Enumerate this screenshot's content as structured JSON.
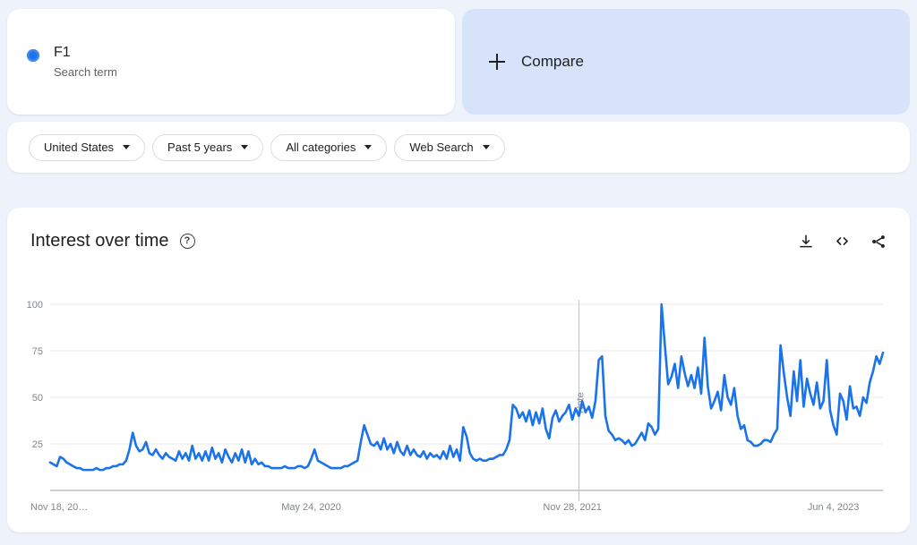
{
  "terms": [
    {
      "title": "F1",
      "subtitle": "Search term",
      "dot_color": "#1a73e8"
    }
  ],
  "compare": {
    "label": "Compare",
    "icon": "plus-icon",
    "bg_color": "#d7e3f9"
  },
  "filters": [
    {
      "label": "United States",
      "icon": "chevron-down-icon"
    },
    {
      "label": "Past 5 years",
      "icon": "chevron-down-icon"
    },
    {
      "label": "All categories",
      "icon": "chevron-down-icon"
    },
    {
      "label": "Web Search",
      "icon": "chevron-down-icon"
    }
  ],
  "chart_card": {
    "title": "Interest over time",
    "help_icon": "help-circle-icon",
    "help_glyph": "?",
    "actions": [
      {
        "name": "download-icon",
        "label": "Download"
      },
      {
        "name": "embed-code-icon",
        "label": "Embed"
      },
      {
        "name": "share-icon",
        "label": "Share"
      }
    ]
  },
  "chart_data": {
    "type": "line",
    "title": "Interest over time",
    "subtitle": "",
    "xlabel": "",
    "ylabel": "",
    "ylim": [
      0,
      100
    ],
    "yticks": [
      25,
      50,
      75,
      100
    ],
    "grid": true,
    "legend": false,
    "line_color": "#1a73e8",
    "annotations": [
      {
        "type": "vline",
        "label": "Note",
        "x_index": 160,
        "x_date": "Dec 2021"
      }
    ],
    "xticks": [
      {
        "label": "Nov 18, 20…",
        "index": 0
      },
      {
        "label": "May 24, 2020",
        "index": 79
      },
      {
        "index": 158,
        "label": "Nov 28, 2021"
      },
      {
        "label": "Jun 4, 2023",
        "index": 237
      }
    ],
    "x_start": "Nov 18, 2018",
    "x_end": "Nov 2023",
    "series": [
      {
        "name": "F1",
        "color": "#1a73e8",
        "values": [
          15,
          14,
          13,
          18,
          17,
          15,
          14,
          13,
          12,
          12,
          11,
          11,
          11,
          11,
          12,
          11,
          11,
          12,
          12,
          13,
          13,
          14,
          14,
          16,
          22,
          31,
          24,
          21,
          22,
          26,
          20,
          19,
          22,
          19,
          17,
          20,
          18,
          17,
          16,
          21,
          17,
          20,
          16,
          24,
          17,
          20,
          16,
          21,
          16,
          23,
          17,
          20,
          15,
          22,
          18,
          15,
          20,
          16,
          22,
          15,
          21,
          14,
          17,
          14,
          15,
          13,
          13,
          12,
          12,
          12,
          12,
          13,
          12,
          12,
          12,
          13,
          13,
          12,
          13,
          17,
          22,
          16,
          15,
          14,
          13,
          12,
          12,
          12,
          12,
          13,
          13,
          14,
          15,
          16,
          26,
          35,
          30,
          25,
          24,
          26,
          22,
          28,
          22,
          25,
          20,
          26,
          21,
          19,
          24,
          19,
          22,
          19,
          18,
          21,
          17,
          20,
          18,
          19,
          17,
          21,
          17,
          24,
          18,
          22,
          16,
          34,
          29,
          20,
          17,
          16,
          17,
          16,
          16,
          17,
          17,
          18,
          19,
          19,
          22,
          27,
          46,
          44,
          39,
          42,
          37,
          43,
          35,
          42,
          36,
          44,
          33,
          28,
          39,
          43,
          37,
          40,
          42,
          46,
          38,
          44,
          40,
          48,
          42,
          45,
          39,
          48,
          70,
          72,
          40,
          32,
          30,
          27,
          28,
          27,
          25,
          27,
          24,
          25,
          28,
          31,
          27,
          36,
          34,
          30,
          33,
          100,
          78,
          57,
          61,
          68,
          55,
          72,
          63,
          56,
          62,
          55,
          66,
          52,
          82,
          56,
          44,
          48,
          53,
          43,
          62,
          50,
          46,
          55,
          40,
          33,
          35,
          27,
          26,
          24,
          24,
          25,
          27,
          27,
          26,
          30,
          33,
          78,
          63,
          50,
          40,
          64,
          48,
          70,
          45,
          60,
          52,
          46,
          58,
          44,
          48,
          70,
          43,
          35,
          30,
          52,
          48,
          38,
          56,
          44,
          45,
          40,
          50,
          47,
          58,
          64,
          72,
          68,
          74
        ]
      }
    ]
  }
}
